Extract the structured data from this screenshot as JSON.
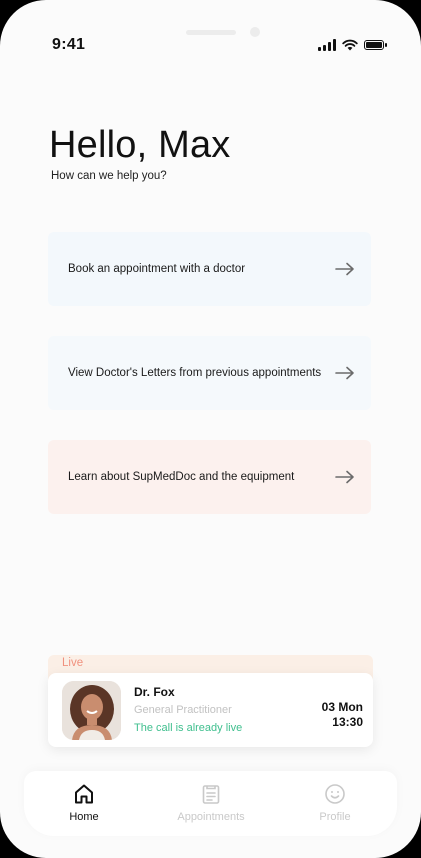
{
  "status_bar": {
    "time": "9:41"
  },
  "header": {
    "greeting": "Hello, Max",
    "subtitle": "How can we help you?"
  },
  "actions": [
    {
      "label": "Book an appointment with a doctor",
      "icon": "arrow-right-icon",
      "color": "#f3f8fc"
    },
    {
      "label": "View Doctor's Letters from previous appointments",
      "icon": "arrow-right-icon",
      "color": "#f5f9fc"
    },
    {
      "label": "Learn about SupMedDoc and the equipment",
      "icon": "arrow-right-icon",
      "color": "#fcf1ee"
    }
  ],
  "live_call": {
    "tag": "Live",
    "doctor_name": "Dr. Fox",
    "role": "General Practitioner",
    "status": "The call is already live",
    "date": "03 Mon",
    "time": "13:30",
    "status_color": "#3fbf8e",
    "tag_color": "#f0917e"
  },
  "tabs": [
    {
      "label": "Home",
      "icon": "home-icon",
      "active": true
    },
    {
      "label": "Appointments",
      "icon": "clipboard-icon",
      "active": false
    },
    {
      "label": "Profile",
      "icon": "smiley-icon",
      "active": false
    }
  ]
}
